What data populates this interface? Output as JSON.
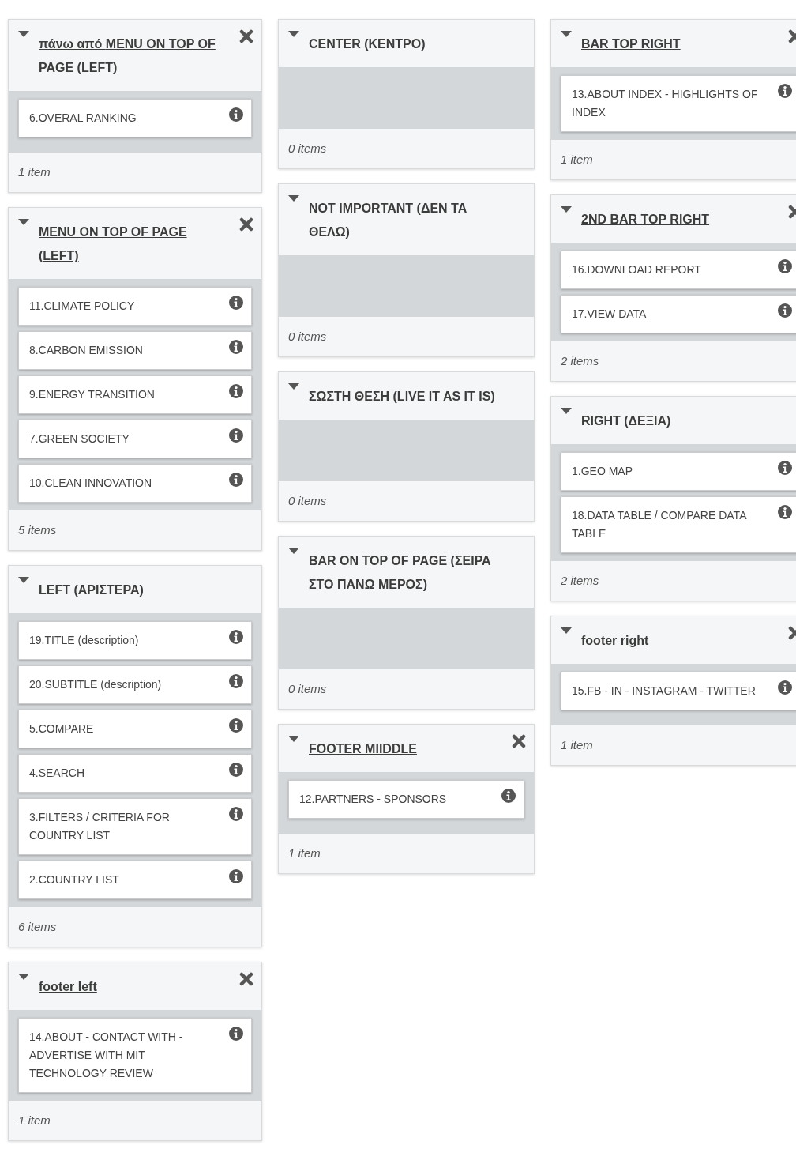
{
  "columns": [
    {
      "panels": [
        {
          "title": "πάνω από **MENU ON TOP OF PAGE (LEFT)**",
          "removable": true,
          "items": [
            "6.OVERAL RANKING"
          ],
          "count": "1 item"
        },
        {
          "title": "MENU ON TOP OF PAGE (LEFT)",
          "removable": true,
          "items": [
            "11.CLIMATE POLICY",
            "8.CARBON EMISSION",
            "9.ENERGY TRANSITION",
            "7.GREEN SOCIETY",
            "10.CLEAN INNOVATION"
          ],
          "count": "5 items"
        },
        {
          "title": "LEFT (ΑΡΙΣΤΕΡΑ)",
          "removable": false,
          "items": [
            "19.TITLE (description)",
            "20.SUBTITLE (description)",
            "5.COMPARE",
            "4.SEARCH",
            "3.FILTERS / CRITERIA FOR COUNTRY LIST",
            "2.COUNTRY LIST"
          ],
          "count": "6 items"
        },
        {
          "title": "footer left",
          "removable": true,
          "items": [
            "14.ABOUT - CONTACT WITH - ADVERTISE WITH MIT TECHNOLOGY REVIEW"
          ],
          "count": "1 item"
        }
      ]
    },
    {
      "panels": [
        {
          "title": "CENTER (ΚΕΝΤΡΟ)",
          "removable": false,
          "count": "0 items"
        },
        {
          "title": "NOT IMPORTANT (ΔΕΝ ΤΑ ΘΕΛΩ)",
          "removable": false,
          "count": "0 items"
        },
        {
          "title": "ΣΩΣΤΗ ΘΕΣΗ (LIVE IT AS IT IS)",
          "removable": false,
          "count": "0 items"
        },
        {
          "title": "BAR ON TOP OF PAGE (ΣΕΙΡΑ ΣΤΟ ΠΑΝΩ ΜΕΡΟΣ)",
          "removable": false,
          "count": "0 items"
        },
        {
          "title": "FOOTER MIIDDLE",
          "removable": true,
          "items": [
            "12.PARTNERS - SPONSORS"
          ],
          "count": "1 item"
        }
      ]
    },
    {
      "panels": [
        {
          "title": "BAR TOP RIGHT",
          "removable": true,
          "items": [
            "13.ABOUT INDEX - HIGHLIGHTS OF INDEX"
          ],
          "count": "1 item"
        },
        {
          "title": "2ND BAR TOP RIGHT",
          "removable": true,
          "items": [
            "16.DOWNLOAD REPORT",
            "17.VIEW DATA"
          ],
          "count": "2 items"
        },
        {
          "title": "RIGHT (ΔΕΞΙΑ)",
          "removable": false,
          "items": [
            "1.GEO MAP",
            "18.DATA TABLE / COMPARE DATA TABLE"
          ],
          "count": "2 items"
        },
        {
          "title": "footer right",
          "removable": true,
          "items": [
            "15.FB - IN - INSTAGRAM - TWITTER"
          ],
          "count": "1 item"
        }
      ]
    }
  ]
}
